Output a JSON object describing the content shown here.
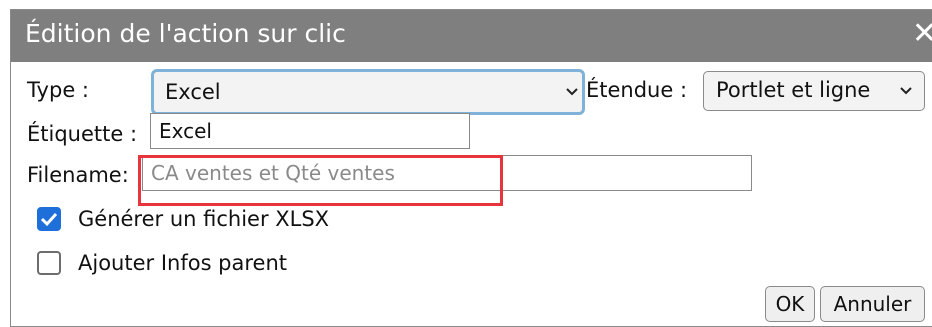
{
  "dialog": {
    "title": "Édition de l'action sur clic",
    "close_glyph": "✕"
  },
  "form": {
    "type_label": "Type :",
    "type_value": "Excel",
    "scope_label": "Étendue :",
    "scope_value": "Portlet et ligne",
    "label_label": "Étiquette :",
    "label_value": "Excel",
    "filename_label": "Filename:",
    "filename_placeholder": "CA ventes et Qté ventes",
    "generate_xlsx_label": "Générer un fichier XLSX",
    "generate_xlsx_checked": true,
    "add_parent_info_label": "Ajouter Infos parent",
    "add_parent_info_checked": false
  },
  "buttons": {
    "ok": "OK",
    "cancel": "Annuler"
  },
  "colors": {
    "titlebar": "#7f7f7f",
    "focus_border": "#7fb2d8",
    "highlight": "#e8343c",
    "checkbox_checked": "#1e6fd9"
  },
  "icons": {
    "close": "close-icon",
    "dropdown": "chevron-down-icon",
    "check": "checkmark-icon"
  }
}
